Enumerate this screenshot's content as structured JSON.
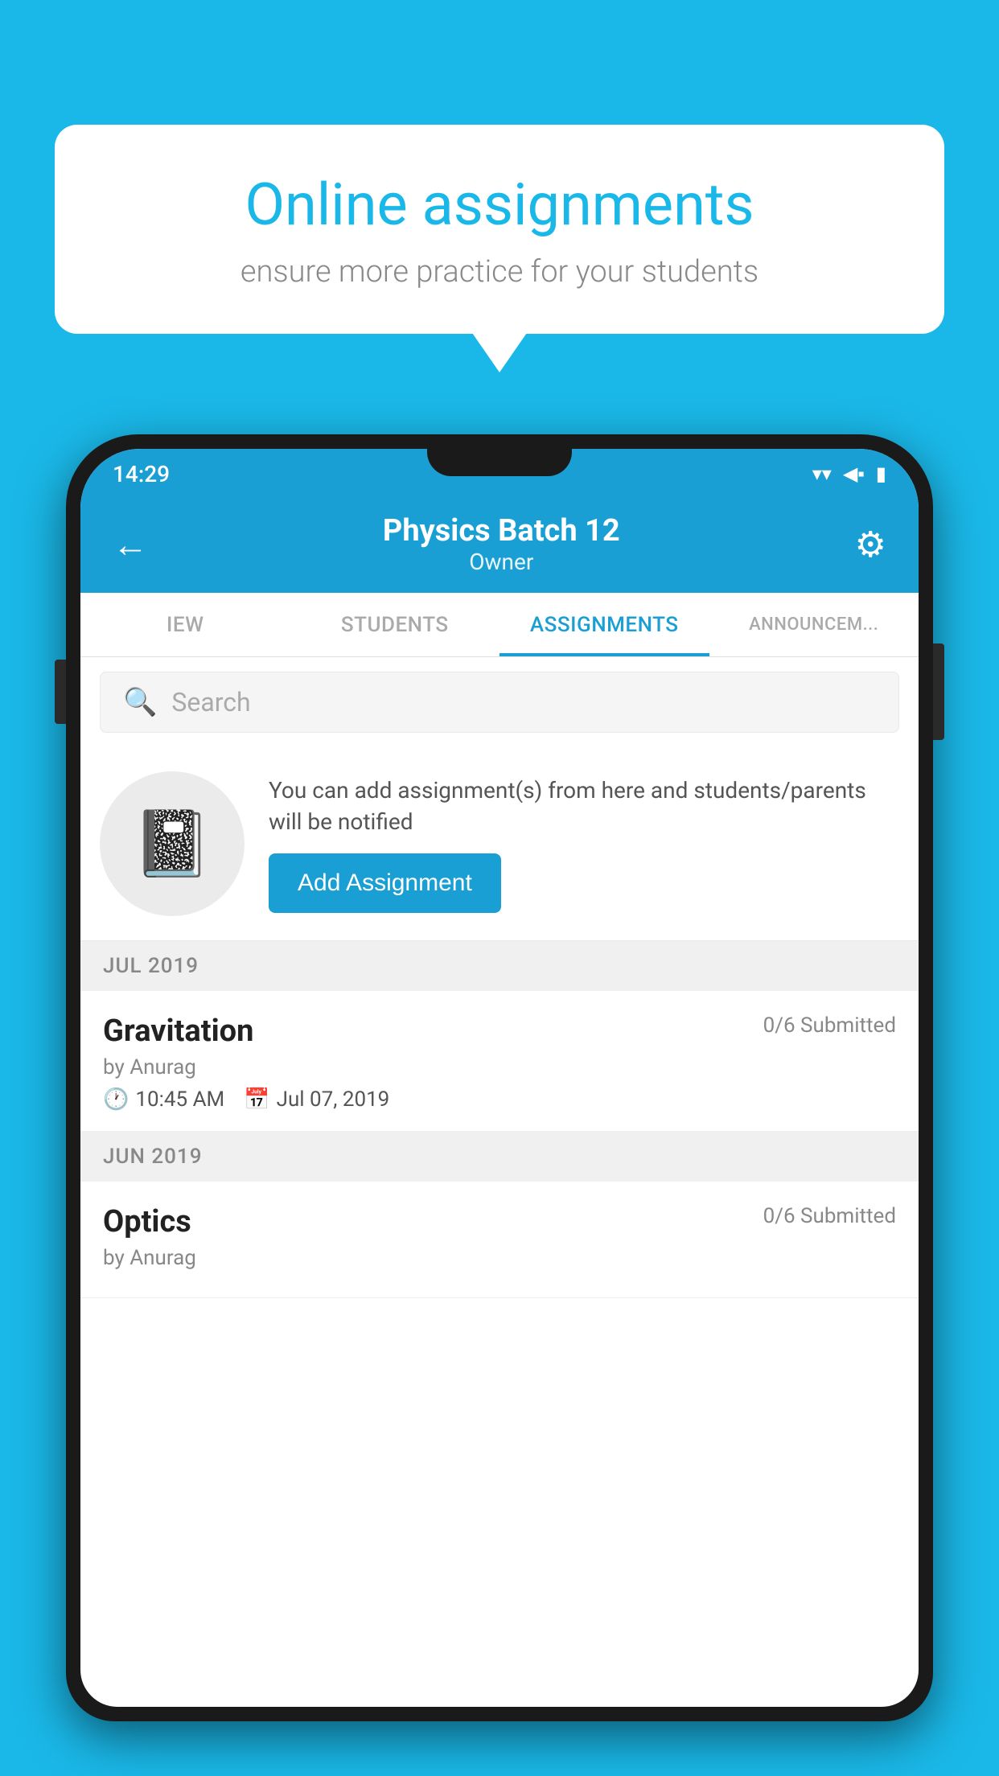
{
  "background_color": "#1ab8e8",
  "speech_bubble": {
    "title": "Online assignments",
    "subtitle": "ensure more practice for your students"
  },
  "status_bar": {
    "time": "14:29",
    "wifi_icon": "▼",
    "signal_icon": "▲",
    "battery_icon": "▪"
  },
  "header": {
    "title": "Physics Batch 12",
    "subtitle": "Owner",
    "back_label": "←",
    "gear_label": "⚙"
  },
  "tabs": [
    {
      "label": "IEW",
      "active": false
    },
    {
      "label": "STUDENTS",
      "active": false
    },
    {
      "label": "ASSIGNMENTS",
      "active": true
    },
    {
      "label": "ANNOUNCEM...",
      "active": false
    }
  ],
  "search": {
    "placeholder": "Search"
  },
  "promo": {
    "description": "You can add assignment(s) from here and students/parents will be notified",
    "button_label": "Add Assignment"
  },
  "sections": [
    {
      "label": "JUL 2019",
      "assignments": [
        {
          "title": "Gravitation",
          "submitted": "0/6 Submitted",
          "by": "by Anurag",
          "time": "10:45 AM",
          "date": "Jul 07, 2019"
        }
      ]
    },
    {
      "label": "JUN 2019",
      "assignments": [
        {
          "title": "Optics",
          "submitted": "0/6 Submitted",
          "by": "by Anurag",
          "time": "",
          "date": ""
        }
      ]
    }
  ]
}
